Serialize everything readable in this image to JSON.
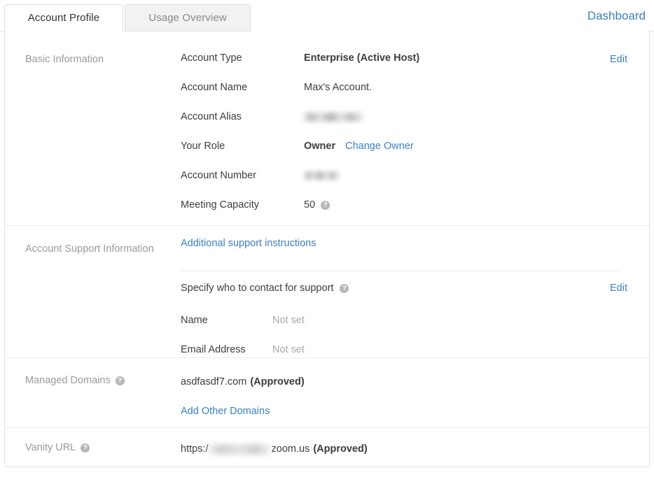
{
  "tabs": [
    {
      "id": "account-profile",
      "label": "Account Profile",
      "active": true
    },
    {
      "id": "usage-overview",
      "label": "Usage Overview",
      "active": false
    }
  ],
  "header": {
    "dashboard_link": "Dashboard"
  },
  "sections": {
    "basic": {
      "label": "Basic Information",
      "edit_label": "Edit",
      "rows": [
        {
          "key": "Account Type",
          "value": "Enterprise (Active Host)",
          "bold": true
        },
        {
          "key": "Account Name",
          "value": "Max's Account.",
          "bold": false
        },
        {
          "key": "Account Alias",
          "value": "",
          "redacted": true
        },
        {
          "key": "Your Role",
          "value": "Owner",
          "bold": true,
          "link": "Change Owner"
        },
        {
          "key": "Account Number",
          "value": "",
          "redacted": true
        },
        {
          "key": "Meeting Capacity",
          "value": "50",
          "bold": false,
          "help": true
        }
      ]
    },
    "support": {
      "label": "Account Support Information",
      "instructions_link": "Additional support instructions",
      "contact_title": "Specify who to contact for support",
      "edit_label": "Edit",
      "rows": [
        {
          "key": "Name",
          "value": "Not set"
        },
        {
          "key": "Email Address",
          "value": "Not set"
        }
      ]
    },
    "domains": {
      "label": "Managed Domains",
      "domain_name": "asdfasdf7.com",
      "domain_status": "(Approved)",
      "add_link": "Add Other Domains"
    },
    "vanity": {
      "label": "Vanity URL",
      "url_prefix": "https:/",
      "url_suffix": "zoom.us",
      "status": "(Approved)"
    }
  },
  "colors": {
    "link": "#3a7fc1",
    "text": "#3c3c3c",
    "muted": "#9a9a9a",
    "border": "#e3e3e3",
    "tab_inactive_bg": "#f2f2f2"
  },
  "icons": {
    "help": "question-mark-circle"
  }
}
